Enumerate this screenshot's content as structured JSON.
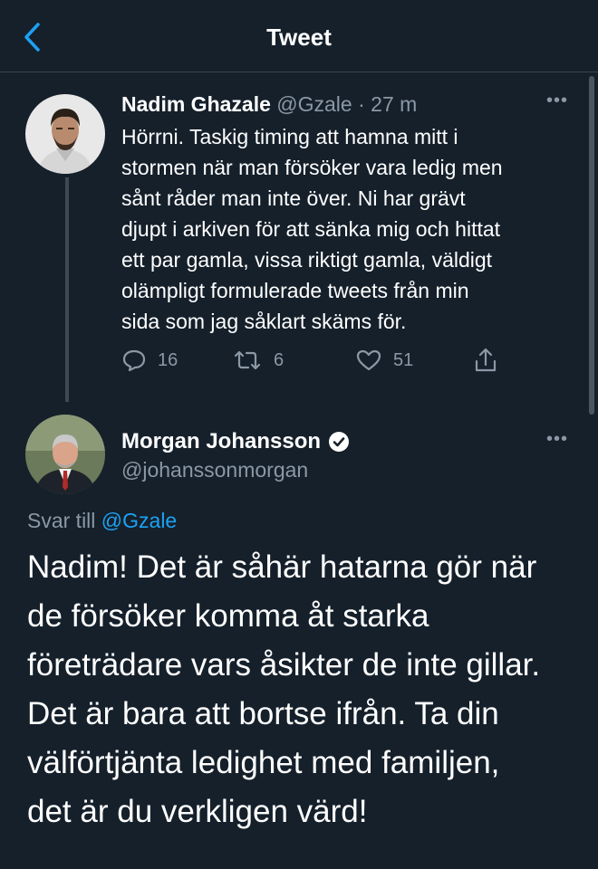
{
  "header": {
    "title": "Tweet"
  },
  "tweet1": {
    "author_name": "Nadim Ghazale",
    "author_handle": "@Gzale",
    "separator": "·",
    "time": "27 m",
    "body_lines": [
      "Hörrni. Taskig timing att hamna mitt i",
      "stormen när man försöker vara ledig men",
      "sånt råder man inte över. Ni har grävt",
      "djupt i arkiven för att sänka mig och hittat",
      "ett par gamla, vissa riktigt gamla, väldigt",
      "olämpligt formulerade tweets från min",
      "sida som jag såklart skäms för."
    ],
    "counts": {
      "replies": "16",
      "retweets": "6",
      "likes": "51"
    }
  },
  "tweet2": {
    "author_name": "Morgan Johansson",
    "author_handle": "@johanssonmorgan",
    "reply_prefix": "Svar till",
    "reply_mention": "@Gzale",
    "body_lines": [
      "Nadim! Det är såhär hatarna gör när",
      "de försöker komma åt starka",
      "företrädare vars åsikter de inte gillar.",
      "Det är bara att bortse ifrån. Ta din",
      "välförtjänta ledighet med familjen,",
      "det är du verkligen värd!"
    ]
  },
  "colors": {
    "background": "#15202b",
    "text": "#ffffff",
    "muted": "#8b98a5",
    "accent": "#1da1f2",
    "divider": "#38444d"
  },
  "icons": [
    "back-chevron-icon",
    "more-icon",
    "reply-icon",
    "retweet-icon",
    "like-icon",
    "share-icon",
    "verified-badge-icon"
  ]
}
